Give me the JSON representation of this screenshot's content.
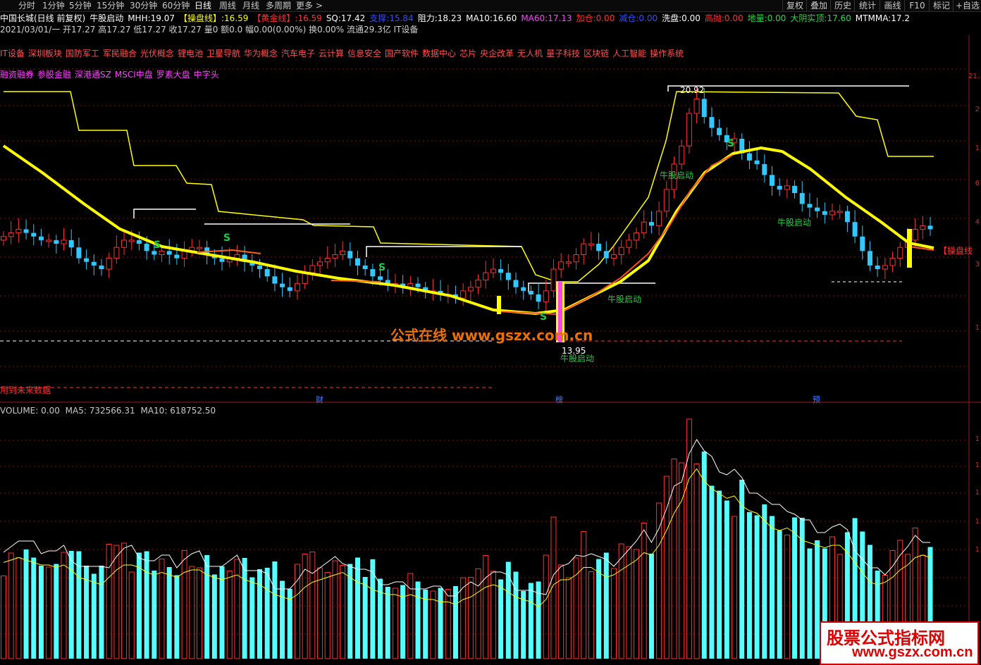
{
  "toolbar": {
    "period_tabs": [
      "分时",
      "1分钟",
      "5分钟",
      "15分钟",
      "30分钟",
      "60分钟",
      "日线",
      "周线",
      "月线",
      "多周期",
      "更多 >"
    ],
    "active_tab": "日线",
    "right_tabs": [
      "复权",
      "叠加",
      "历史",
      "统计",
      "画线",
      "F10",
      "标记",
      "+自选"
    ]
  },
  "info_line1": {
    "stock": "中国长城(日线 前复权)",
    "indicator": "牛股启动",
    "items": [
      {
        "label": "MHH:",
        "value": "19.07",
        "color": "#ffffff"
      },
      {
        "label": "【操盘线】:",
        "value": "16.59",
        "color": "#ffff00"
      },
      {
        "label": "【黄金线】:",
        "value": "16.59",
        "color": "#ff3030"
      },
      {
        "label": "SQ:",
        "value": "17.42",
        "color": "#ffffff"
      },
      {
        "label": "支撑:",
        "value": "15.84",
        "color": "#3050ff"
      },
      {
        "label": "阻力:",
        "value": "18.23",
        "color": "#ffffff"
      },
      {
        "label": "MA10:",
        "value": "16.60",
        "color": "#ffffff"
      },
      {
        "label": "MA60:",
        "value": "17.13",
        "color": "#ff40ff"
      },
      {
        "label": "加仓:",
        "value": "0.00",
        "color": "#ff3030"
      },
      {
        "label": "减仓:",
        "value": "0.00",
        "color": "#3050ff"
      },
      {
        "label": "洗盘:",
        "value": "0.00",
        "color": "#ffffff"
      },
      {
        "label": "高抛:",
        "value": "0.00",
        "color": "#ff3030"
      },
      {
        "label": "地量:",
        "value": "0.00",
        "color": "#22dd44"
      },
      {
        "label": "大阴实顶:",
        "value": "17.60",
        "color": "#22dd44"
      },
      {
        "label": "MTMMA:",
        "value": "17.2",
        "color": "#ffffff"
      }
    ]
  },
  "info_line2": "2021/03/01/一 开17.27 高17.27 低17.27 收17.27 量0 额0.0 幅0.00(0.00%) 换0.00% 流通29.3亿 IT设备",
  "concept_tags_1": [
    "IT设备",
    "深圳板块",
    "国防军工",
    "军民融合",
    "光伏概念",
    "锂电池",
    "卫星导航",
    "华为概念",
    "汽车电子",
    "云计算",
    "信息安全",
    "国产软件",
    "数据中心",
    "芯片",
    "央企改革",
    "无人机",
    "量子科技",
    "区块链",
    "人工智能",
    "操作系统"
  ],
  "concept_tags_2": [
    "融资融券",
    "参股金融",
    "深港通SZ",
    "MSCI中盘",
    "罗素大盘",
    "中字头"
  ],
  "main_chart": {
    "price_labels": {
      "peak": "20.92",
      "low": "13.95"
    },
    "signal_label": "牛股启动",
    "s_marker": "S",
    "line_label": "【操盘线",
    "future_note": "用到未来数据",
    "bottom_markers": [
      "财",
      "榜",
      "预"
    ],
    "watermark": "公式在线 www.gszx.com.cn",
    "axis_ticks": [
      "21.",
      "2",
      "1",
      "6",
      "4",
      "3",
      "1"
    ]
  },
  "volume_header": {
    "label": "VOLUME:",
    "value": "0.00",
    "ma5_label": "MA5:",
    "ma5": "732566.31",
    "ma10_label": "MA10:",
    "ma10": "618752.50"
  },
  "volume_axis_ticks": [
    "1",
    "1",
    "1",
    "1",
    "1"
  ],
  "watermark_box": {
    "line1": "股票公式指标网",
    "line2": "www.gszx.com.cn"
  },
  "colors": {
    "up": "#ff3030",
    "down": "#30c8ff",
    "cyan": "#5ff",
    "yellow": "#ffff00",
    "white": "#ffffff",
    "magenta": "#ff40ff",
    "gridline": "#8a1010"
  },
  "chart_data": {
    "type": "bar",
    "x": [
      1,
      2,
      3,
      4,
      5,
      6,
      7,
      8,
      9,
      10,
      11,
      12,
      13,
      14,
      15,
      16,
      17,
      18,
      19,
      20,
      21,
      22,
      23,
      24,
      25,
      26,
      27,
      28,
      29,
      30,
      31,
      32,
      33,
      34,
      35,
      36,
      37,
      38,
      39,
      40,
      41,
      42,
      43,
      44,
      45,
      46,
      47,
      48,
      49,
      50,
      51,
      52,
      53,
      54,
      55,
      56,
      57,
      58,
      59,
      60,
      61,
      62,
      63,
      64,
      65,
      66,
      67,
      68,
      69,
      70,
      71,
      72,
      73,
      74,
      75,
      76,
      77,
      78,
      79,
      80,
      81,
      82,
      83,
      84,
      85,
      86,
      87,
      88,
      89,
      90,
      91,
      92,
      93,
      94,
      95,
      96,
      97,
      98,
      99,
      100,
      101,
      102,
      103,
      104,
      105,
      106,
      107,
      108,
      109,
      110,
      111,
      112,
      113,
      114,
      115,
      116,
      117,
      118,
      119,
      120,
      121,
      122,
      123,
      124,
      125,
      126,
      127,
      128,
      129,
      130,
      131,
      132,
      133,
      134,
      135,
      136,
      137,
      138,
      139,
      140,
      141,
      142,
      143,
      144,
      145,
      146,
      147,
      148,
      149,
      150,
      151,
      152,
      153,
      154
    ],
    "candles_close": [
      16.9,
      17.0,
      17.1,
      17.0,
      16.9,
      16.8,
      16.8,
      16.7,
      16.8,
      16.6,
      16.3,
      16.2,
      16.1,
      16.0,
      16.3,
      16.6,
      16.8,
      16.8,
      16.7,
      16.5,
      16.4,
      16.5,
      16.4,
      16.3,
      16.5,
      16.6,
      16.6,
      16.4,
      16.3,
      16.2,
      16.3,
      16.4,
      16.2,
      16.1,
      16.0,
      15.8,
      15.6,
      15.5,
      15.4,
      15.6,
      15.9,
      16.1,
      16.2,
      16.3,
      16.4,
      16.5,
      16.3,
      16.1,
      16.0,
      15.8,
      15.7,
      15.6,
      15.6,
      15.5,
      15.6,
      15.5,
      15.4,
      15.4,
      15.3,
      15.3,
      15.2,
      15.4,
      15.5,
      15.7,
      15.9,
      16.0,
      15.9,
      15.7,
      15.5,
      15.4,
      15.3,
      15.1,
      15.4,
      16.0,
      16.2,
      16.2,
      16.4,
      16.7,
      16.7,
      16.5,
      16.3,
      16.4,
      16.6,
      16.8,
      17.0,
      17.3,
      17.2,
      17.6,
      18.2,
      18.9,
      19.4,
      20.3,
      20.7,
      20.2,
      19.9,
      19.7,
      19.5,
      19.6,
      19.2,
      19.0,
      18.9,
      18.6,
      18.3,
      18.2,
      18.3,
      18.1,
      17.8,
      17.7,
      17.6,
      17.5,
      17.6,
      17.6,
      17.3,
      16.9,
      16.5,
      16.1,
      16.0,
      16.1,
      16.3,
      16.6,
      16.8,
      17.1,
      17.2,
      17.1
    ],
    "volume_ma5": [
      732566.31
    ],
    "volume_ma10": [
      618752.5
    ]
  }
}
